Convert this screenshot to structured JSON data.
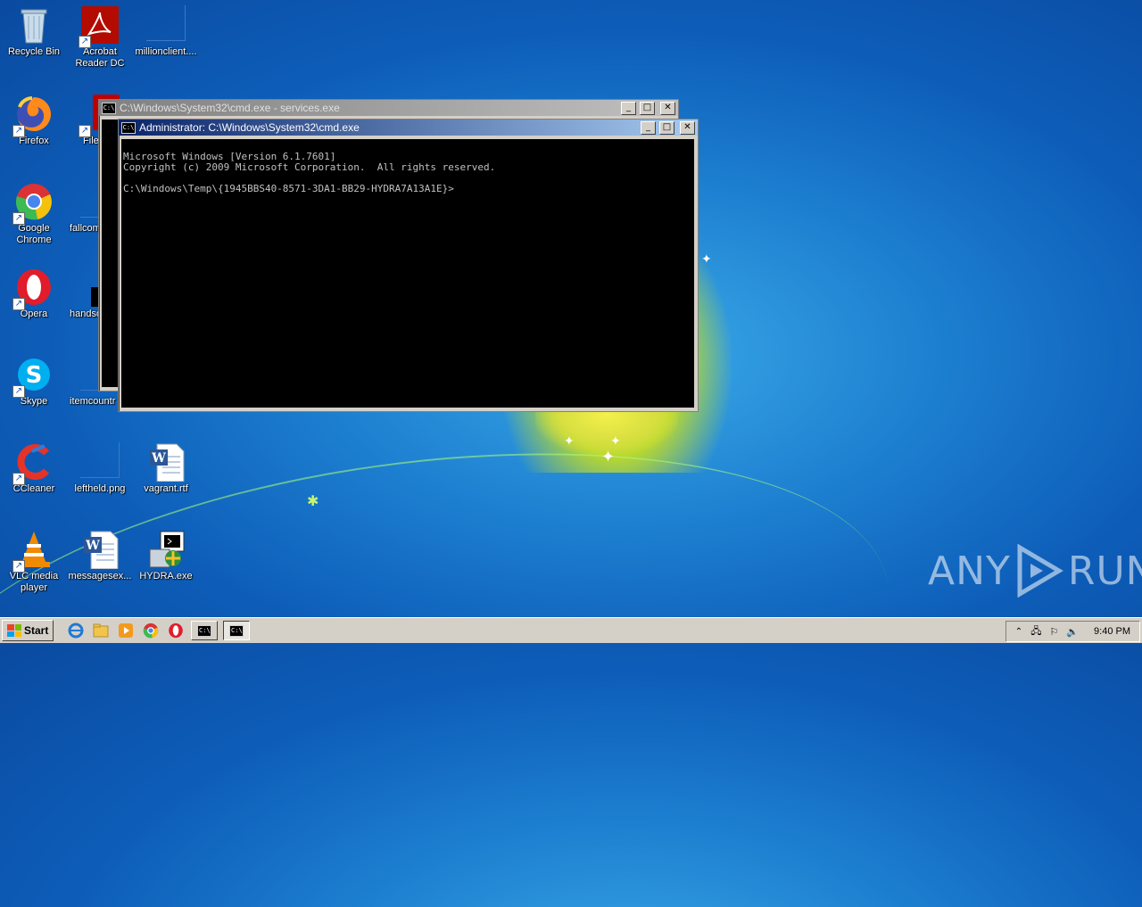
{
  "desktop": {
    "icons": [
      {
        "label": "Recycle Bin"
      },
      {
        "label": "Acrobat Reader DC"
      },
      {
        "label": "millionclient...."
      },
      {
        "label": "Firefox"
      },
      {
        "label": "FileZilla"
      },
      {
        "label": "Google Chrome"
      },
      {
        "label": "fallcom"
      },
      {
        "label": "Opera"
      },
      {
        "label": "handso"
      },
      {
        "label": "Skype"
      },
      {
        "label": "itemcountr"
      },
      {
        "label": "CCleaner"
      },
      {
        "label": "leftheld.png"
      },
      {
        "label": "vagrant.rtf"
      },
      {
        "label": "VLC media player"
      },
      {
        "label": "messagesex..."
      },
      {
        "label": "HYDRA.exe"
      }
    ]
  },
  "windows": {
    "back": {
      "title": "C:\\Windows\\System32\\cmd.exe - services.exe"
    },
    "front": {
      "title": "Administrator: C:\\Windows\\System32\\cmd.exe",
      "lines": [
        "Microsoft Windows [Version 6.1.7601]",
        "Copyright (c) 2009 Microsoft Corporation.  All rights reserved.",
        "",
        "C:\\Windows\\Temp\\{1945BBS40-8571-3DA1-BB29-HYDRA7A13A1E}>"
      ]
    }
  },
  "taskbar": {
    "start_label": "Start",
    "clock": "9:40 PM"
  },
  "watermark": {
    "text_left": "ANY",
    "text_right": "RUN"
  }
}
